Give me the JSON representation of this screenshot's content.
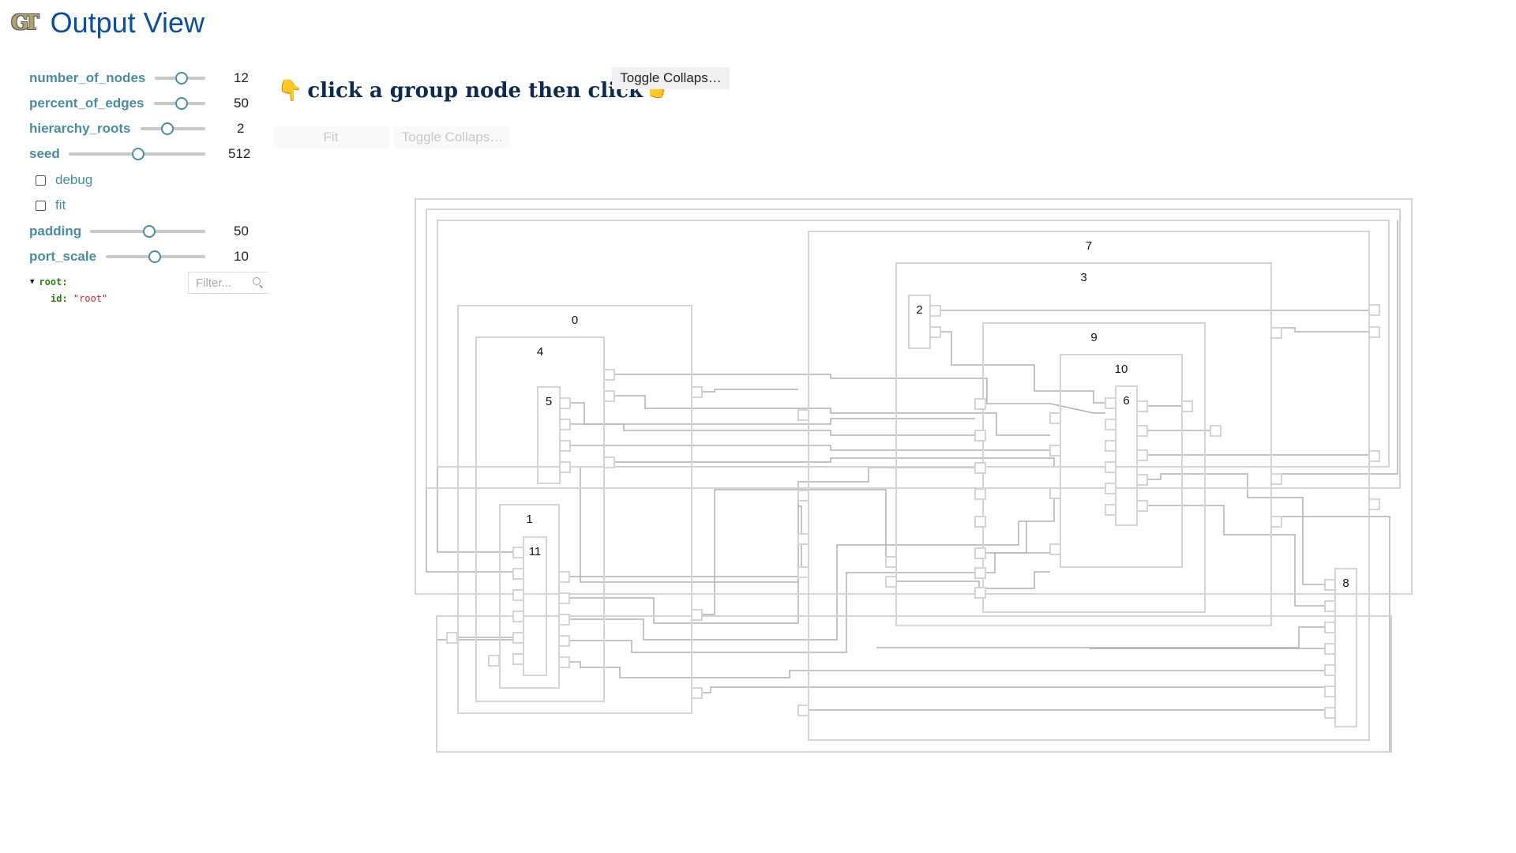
{
  "header": {
    "title": "Output View",
    "logo": "GT"
  },
  "controls": {
    "number_of_nodes": {
      "label": "number_of_nodes",
      "value": "12",
      "fraction": 0.5
    },
    "percent_of_edges": {
      "label": "percent_of_edges",
      "value": "50",
      "fraction": 0.5
    },
    "hierarchy_roots": {
      "label": "hierarchy_roots",
      "value": "2",
      "fraction": 0.33
    },
    "seed": {
      "label": "seed",
      "value": "512",
      "fraction": 0.5
    },
    "debug": {
      "label": "debug",
      "checked": false
    },
    "fit": {
      "label": "fit",
      "checked": false
    },
    "padding": {
      "label": "padding",
      "value": "50",
      "fraction": 0.5
    },
    "port_scale": {
      "label": "port_scale",
      "value": "10",
      "fraction": 0.5
    }
  },
  "inspector": {
    "root_key": "root:",
    "id_key": "id:",
    "id_value": "\"root\"",
    "filter_placeholder": "Filter..."
  },
  "toolbar": {
    "prompt": "click a group node then click",
    "prompt_left_icon": "👇",
    "prompt_right_icon": "👉",
    "toggle_collapse_label": "Toggle Collaps…",
    "fit_label": "Fit",
    "toggle_collapse_disabled_label": "Toggle Collaps…"
  },
  "graph": {
    "node_labels": [
      "0",
      "1",
      "2",
      "3",
      "4",
      "5",
      "6",
      "7",
      "8",
      "9",
      "10",
      "11"
    ]
  }
}
